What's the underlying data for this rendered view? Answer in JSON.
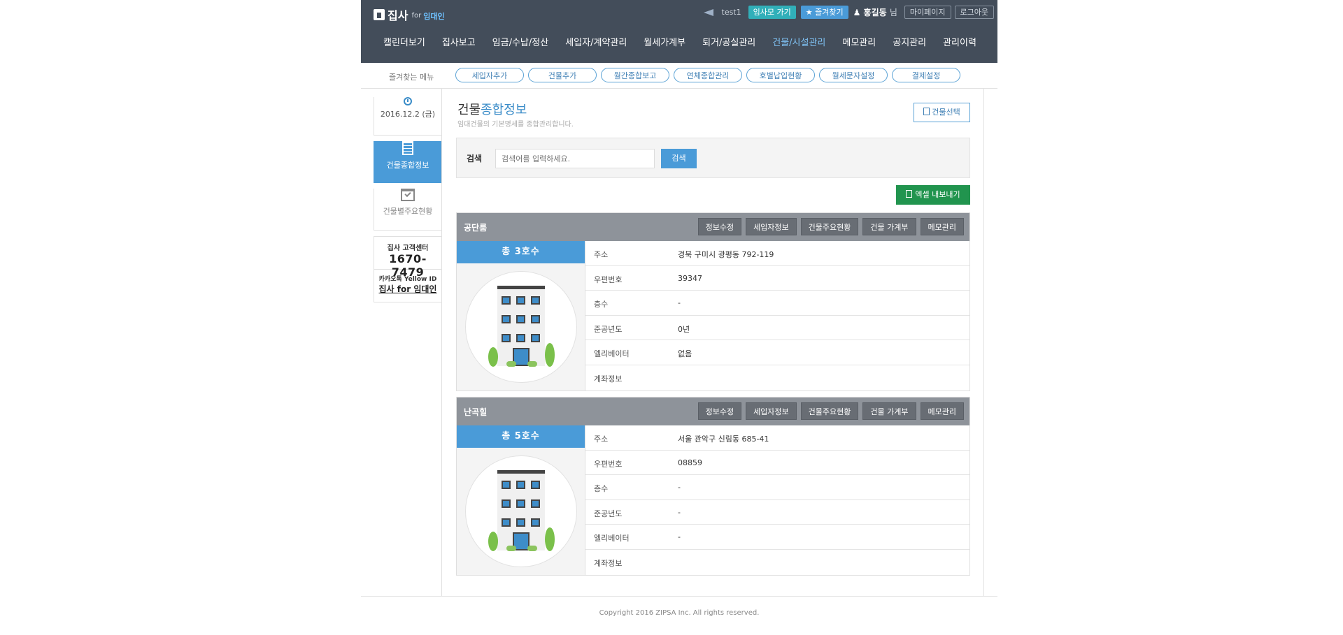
{
  "header": {
    "brand": "집사",
    "brand_for": "for",
    "brand_sub": "임대인",
    "user_id": "test1",
    "goto_tenant_label": "임사모 가기",
    "favorites_label": "즐겨찾기",
    "person_name": "홍길동",
    "person_suffix": "님",
    "mypage_label": "마이페이지",
    "logout_label": "로그아웃",
    "nav": [
      "캘린더보기",
      "집사보고",
      "임금/수납/정산",
      "세입자/계약관리",
      "월세가계부",
      "퇴거/공실관리",
      "건물/시설관리",
      "메모관리",
      "공지관리",
      "관리이력"
    ],
    "active_nav": "건물/시설관리"
  },
  "favbar": {
    "label": "즐겨찾는 메뉴",
    "items": [
      "세입자추가",
      "건물추가",
      "월간종합보고",
      "연체종합관리",
      "호별납입현황",
      "월세문자설정",
      "결제설정"
    ]
  },
  "sidebar": {
    "date": "2016.12.2 (금)",
    "items": [
      {
        "label": "건물종합정보",
        "active": true,
        "icon": "building-icon"
      },
      {
        "label": "건물별주요현황",
        "active": false,
        "icon": "calendar-check-icon"
      }
    ],
    "cs_title": "집사 고객센터",
    "cs_phone": "1670-7479",
    "kakao_title": "카카오톡 Yellow ID",
    "kakao_id": "집사 for 임대인"
  },
  "main": {
    "title_pre": "건물",
    "title_hl": "종합정보",
    "desc": "임대건물의 기본명세를 종합관리합니다.",
    "select_building_label": "건물선택",
    "search_label": "검색",
    "search_placeholder": "검색어를 입력하세요.",
    "search_button": "검색",
    "excel_button": "엑셀 내보내기",
    "card_buttons": [
      "정보수정",
      "세입자정보",
      "건물주요현황",
      "건물 가계부",
      "메모관리"
    ],
    "buildings": [
      {
        "name": "공단룸",
        "units": "총 3호수",
        "rows": [
          {
            "k": "주소",
            "v": "경북 구미시 광평동 792-119"
          },
          {
            "k": "우편번호",
            "v": "39347"
          },
          {
            "k": "층수",
            "v": "-"
          },
          {
            "k": "준공년도",
            "v": "0년"
          },
          {
            "k": "엘리베이터",
            "v": "없음"
          },
          {
            "k": "계좌정보",
            "v": ""
          }
        ]
      },
      {
        "name": "난곡힐",
        "units": "총 5호수",
        "rows": [
          {
            "k": "주소",
            "v": "서울 관악구 신림동 685-41"
          },
          {
            "k": "우편번호",
            "v": "08859"
          },
          {
            "k": "층수",
            "v": "-"
          },
          {
            "k": "준공년도",
            "v": "-"
          },
          {
            "k": "엘리베이터",
            "v": "-"
          },
          {
            "k": "계좌정보",
            "v": ""
          }
        ]
      }
    ]
  },
  "footer": {
    "copyright": "Copyright 2016 ZIPSA Inc. All rights reserved."
  }
}
